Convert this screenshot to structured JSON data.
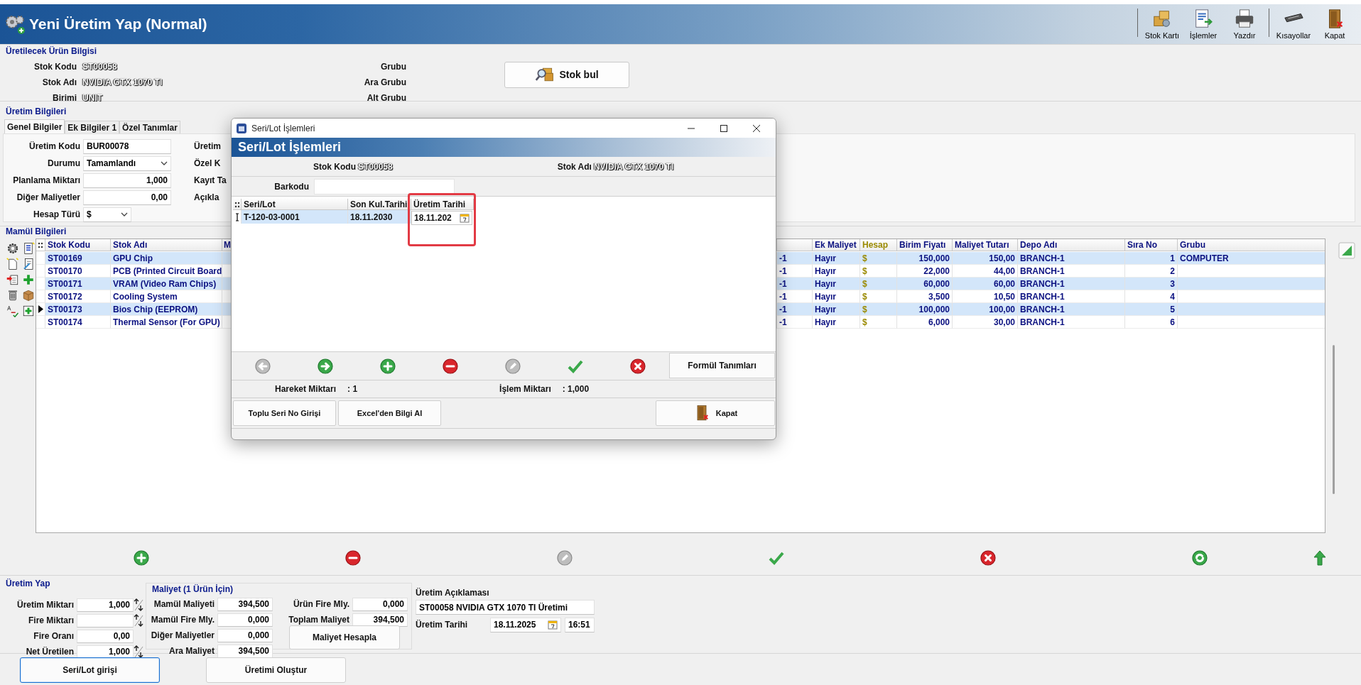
{
  "window": {
    "title": "Yeni Üretim Yap (Normal)"
  },
  "toolbar": [
    {
      "label": "Stok Kartı",
      "kind": "boxes"
    },
    {
      "label": "İşlemler",
      "kind": "list"
    },
    {
      "label": "Yazdır",
      "kind": "printer"
    },
    {
      "label": "Kısayollar",
      "kind": "keyboard"
    },
    {
      "label": "Kapat",
      "kind": "door"
    }
  ],
  "product_info": {
    "title": "Üretilecek Ürün Bilgisi",
    "fields": [
      {
        "label": "Stok Kodu",
        "value": "ST00058"
      },
      {
        "label": "Stok Adı",
        "value": "NVIDIA GTX 1070 TI"
      },
      {
        "label": "Birimi",
        "value": "UNIT"
      }
    ],
    "group_labels": [
      "Grubu",
      "Ara Grubu",
      "Alt Grubu"
    ],
    "search_button": "Stok bul"
  },
  "production_info": {
    "title": "Üretim Bilgileri",
    "tabs": [
      {
        "label": "Genel Bilgiler",
        "selected": true
      },
      {
        "label": "Ek Bilgiler 1",
        "selected": false
      },
      {
        "label": "Özel Tanımlar",
        "selected": false
      }
    ],
    "fields": [
      {
        "label": "Üretim Kodu",
        "kind": "text",
        "value": "BUR00078"
      },
      {
        "label": "Durumu",
        "kind": "select",
        "value": "Tamamlandı"
      },
      {
        "label": "Planlama Miktarı",
        "kind": "number",
        "value": "1,000"
      },
      {
        "label": "Diğer Maliyetler",
        "kind": "number",
        "value": "0,00"
      },
      {
        "label": "Hesap Türü",
        "kind": "select_small",
        "value": "$"
      }
    ],
    "column_2_labels": [
      "Üretim",
      "Özel K",
      "Kayıt Ta",
      "Açıkla"
    ]
  },
  "components": {
    "title": "Mamül Bilgileri",
    "columns": [
      {
        "label": "Stok Kodu",
        "kind": "text"
      },
      {
        "label": "Stok Adı",
        "kind": "text"
      },
      {
        "label": "M",
        "kind": "text"
      },
      {
        "kind": "text"
      },
      {
        "label": "Ek Maliyet",
        "kind": "text"
      },
      {
        "label": "Hesap",
        "kind": "currency"
      },
      {
        "label": "Birim Fiyatı",
        "kind": "number"
      },
      {
        "label": "Maliyet Tutarı",
        "kind": "number"
      },
      {
        "label": "Depo Adı",
        "kind": "text"
      },
      {
        "label": "Sıra No",
        "kind": "number"
      },
      {
        "label": "Grubu",
        "kind": "text"
      }
    ],
    "rows": [
      {
        "current": false,
        "cells": [
          "ST00169",
          "GPU Chip",
          null,
          "-1",
          "Hayır",
          "$",
          "150,000",
          "150,00",
          "BRANCH-1",
          "1",
          "COMPUTER"
        ]
      },
      {
        "current": false,
        "cells": [
          "ST00170",
          "PCB (Printed Circuit Board",
          null,
          "-1",
          "Hayır",
          "$",
          "22,000",
          "44,00",
          "BRANCH-1",
          "2",
          null
        ]
      },
      {
        "current": false,
        "cells": [
          "ST00171",
          "VRAM (Video Ram Chips)",
          null,
          "-1",
          "Hayır",
          "$",
          "60,000",
          "60,00",
          "BRANCH-1",
          "3",
          null
        ]
      },
      {
        "current": false,
        "cells": [
          "ST00172",
          "Cooling System",
          null,
          "-1",
          "Hayır",
          "$",
          "3,500",
          "10,50",
          "BRANCH-1",
          "4",
          null
        ]
      },
      {
        "current": true,
        "cells": [
          "ST00173",
          "Bios Chip (EEPROM)",
          null,
          "-1",
          "Hayır",
          "$",
          "100,000",
          "100,00",
          "BRANCH-1",
          "5",
          null
        ]
      },
      {
        "current": false,
        "cells": [
          "ST00174",
          "Thermal Sensor (For GPU)",
          null,
          "-1",
          "Hayır",
          "$",
          "6,000",
          "30,00",
          "BRANCH-1",
          "6",
          null
        ]
      }
    ],
    "tools": [
      {
        "kind": "add",
        "disabled": false
      },
      {
        "kind": "remove",
        "disabled": false
      },
      {
        "kind": "edit",
        "disabled": true
      },
      {
        "kind": "confirm",
        "disabled": false
      },
      {
        "kind": "cancel",
        "disabled": false
      },
      {
        "kind": "refresh",
        "disabled": false
      },
      {
        "kind": "up",
        "disabled": false
      }
    ]
  },
  "production": {
    "title": "Üretim Yap",
    "fields": [
      {
        "label": "Üretim Miktarı",
        "kind": "spin",
        "value": "1,000"
      },
      {
        "label": "Fire Miktarı",
        "kind": "spin"
      },
      {
        "label": "Fire Oranı",
        "kind": "text",
        "value": "0,00"
      },
      {
        "label": "Net Üretilen",
        "kind": "spin",
        "value": "1,000"
      }
    ]
  },
  "cost": {
    "title": "Maliyet (1 Ürün İçin)",
    "fields": [
      {
        "label": "Mamül Maliyeti",
        "value": "394,500"
      },
      {
        "label": "Mamül Fire Mly.",
        "value": "0,000"
      },
      {
        "label": "Diğer Maliyetler",
        "value": "0,000"
      },
      {
        "label": "Ara Maliyet",
        "value": "394,500"
      }
    ],
    "totals": [
      {
        "label": "Ürün Fire Mly.",
        "value": "0,000"
      },
      {
        "label": "Toplam Maliyet",
        "value": "394,500"
      }
    ],
    "button": "Maliyet Hesapla"
  },
  "description": {
    "label": "Üretim Açıklaması",
    "value": "ST00058 NVIDIA GTX 1070 TI Üretimi",
    "date_label": "Üretim Tarihi",
    "date": "18.11.2025",
    "time": "16:51"
  },
  "actions": [
    {
      "label": "Seri/Lot girişi",
      "focused": true
    },
    {
      "label": "Üretimi Oluştur",
      "focused": false
    }
  ],
  "dialog": {
    "title": "Seri/Lot İşlemleri",
    "banner": "Seri/Lot İşlemleri",
    "fields": [
      {
        "label": "Stok Kodu",
        "value": "ST00058"
      },
      {
        "label": "Stok Adı",
        "value": "NVIDIA GTX 1070 TI"
      }
    ],
    "barcode_label": "Barkodu",
    "columns": [
      {
        "label": "Seri/Lot",
        "highlighted": false
      },
      {
        "label": "Son Kul.Tarihi",
        "highlighted": false
      },
      {
        "label": "Üretim Tarihi",
        "highlighted": true
      }
    ],
    "rows": [
      {
        "current": true,
        "cells": [
          {
            "text": "T-120-03-0001",
            "editing": false
          },
          {
            "text": "18.11.2030",
            "editing": false
          },
          {
            "text": "18.11.202",
            "editing": true
          }
        ]
      }
    ],
    "tools": [
      {
        "kind": "prev",
        "disabled": true
      },
      {
        "kind": "next",
        "disabled": false
      },
      {
        "kind": "add",
        "disabled": false
      },
      {
        "kind": "remove",
        "disabled": false
      },
      {
        "kind": "edit",
        "disabled": true
      },
      {
        "kind": "confirm",
        "disabled": false
      },
      {
        "kind": "cancel",
        "disabled": false
      }
    ],
    "formula_button": "Formül Tanımları",
    "totals": [
      {
        "label": "Hareket Miktarı",
        "value": ": 1"
      },
      {
        "label": "İşlem Miktarı",
        "value": ": 1,000"
      }
    ],
    "buttons": [
      {
        "label": "Toplu Seri No Girişi",
        "kind": "plain"
      },
      {
        "label": "Excel'den Bilgi Al",
        "kind": "plain"
      },
      {
        "label": "Kapat",
        "kind": "close"
      }
    ]
  }
}
